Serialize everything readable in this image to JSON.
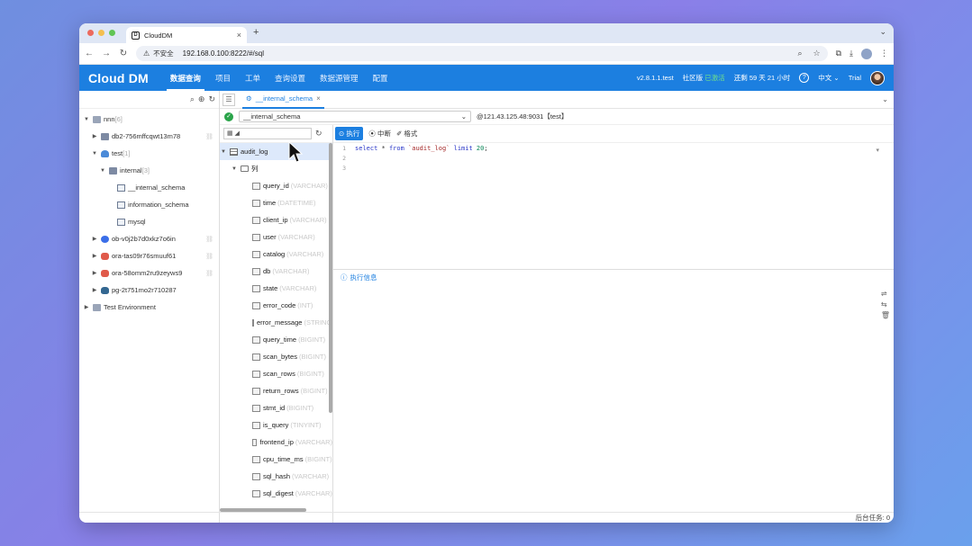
{
  "browser": {
    "tab_title": "CloudDM",
    "insecure_label": "不安全",
    "url": "192.168.0.100:8222/#/sql"
  },
  "app": {
    "logo": "Cloud DM",
    "menu": [
      "数据查询",
      "项目",
      "工单",
      "查询设置",
      "数据源管理",
      "配置"
    ],
    "version": "v2.8.1.1.test",
    "edition_prefix": "社区版",
    "edition_status": "已激活",
    "remaining": "还剩 59 天 21 小时",
    "language": "中文",
    "user": "Trial"
  },
  "tree": [
    {
      "caret": "▼",
      "indent": 0,
      "icon": "env",
      "label": "nnn",
      "count": "[6]"
    },
    {
      "caret": "▶",
      "indent": 1,
      "icon": "db",
      "label": "db2-756mffcqwt13m78",
      "link": true
    },
    {
      "caret": "▼",
      "indent": 1,
      "icon": "mysql",
      "label": "test",
      "count": "[1]"
    },
    {
      "caret": "▼",
      "indent": 2,
      "icon": "db",
      "label": "internal",
      "count": "[3]"
    },
    {
      "caret": "",
      "indent": 3,
      "icon": "schema",
      "label": "__internal_schema"
    },
    {
      "caret": "",
      "indent": 3,
      "icon": "schema",
      "label": "information_schema"
    },
    {
      "caret": "",
      "indent": 3,
      "icon": "schema",
      "label": "mysql"
    },
    {
      "caret": "▶",
      "indent": 1,
      "icon": "ob",
      "label": "ob-v0j2b7d0xkz7o6in",
      "link": true
    },
    {
      "caret": "▶",
      "indent": 1,
      "icon": "ora",
      "label": "ora-tas09r76smuuf61",
      "link": true
    },
    {
      "caret": "▶",
      "indent": 1,
      "icon": "ora",
      "label": "ora-58omm2ru9zeyws9",
      "link": true
    },
    {
      "caret": "▶",
      "indent": 1,
      "icon": "pg",
      "label": "pg-2t751mo2r710287"
    },
    {
      "caret": "▶",
      "indent": 0,
      "icon": "env",
      "label": "Test Environment"
    }
  ],
  "query_tab": {
    "label": "__internal_schema"
  },
  "connection": {
    "schema": "__internal_schema",
    "host": "@121.43.125.48:9031【test】"
  },
  "object_panel": {
    "table": "audit_log",
    "folder": "列",
    "columns": [
      {
        "name": "query_id",
        "type": "(VARCHAR)"
      },
      {
        "name": "time",
        "type": "(DATETIME)"
      },
      {
        "name": "client_ip",
        "type": "(VARCHAR)"
      },
      {
        "name": "user",
        "type": "(VARCHAR)"
      },
      {
        "name": "catalog",
        "type": "(VARCHAR)"
      },
      {
        "name": "db",
        "type": "(VARCHAR)"
      },
      {
        "name": "state",
        "type": "(VARCHAR)"
      },
      {
        "name": "error_code",
        "type": "(INT)"
      },
      {
        "name": "error_message",
        "type": "(STRING)"
      },
      {
        "name": "query_time",
        "type": "(BIGINT)"
      },
      {
        "name": "scan_bytes",
        "type": "(BIGINT)"
      },
      {
        "name": "scan_rows",
        "type": "(BIGINT)"
      },
      {
        "name": "return_rows",
        "type": "(BIGINT)"
      },
      {
        "name": "stmt_id",
        "type": "(BIGINT)"
      },
      {
        "name": "is_query",
        "type": "(TINYINT)"
      },
      {
        "name": "frontend_ip",
        "type": "(VARCHAR)"
      },
      {
        "name": "cpu_time_ms",
        "type": "(BIGINT)"
      },
      {
        "name": "sql_hash",
        "type": "(VARCHAR)"
      },
      {
        "name": "sql_digest",
        "type": "(VARCHAR)"
      }
    ]
  },
  "editor": {
    "run": "执行",
    "stop": "中断",
    "format": "格式",
    "lines": [
      "1",
      "2",
      "3"
    ],
    "sql": {
      "k1": "select",
      "star": "*",
      "k2": "from",
      "table": "`audit_log`",
      "k3": "limit",
      "limit": "20",
      "end": ";"
    }
  },
  "results": {
    "tab": "执行信息"
  },
  "status": {
    "background_tasks": "后台任务: 0"
  },
  "colors": {
    "primary": "#1c7fe0",
    "success": "#2aa44a"
  }
}
